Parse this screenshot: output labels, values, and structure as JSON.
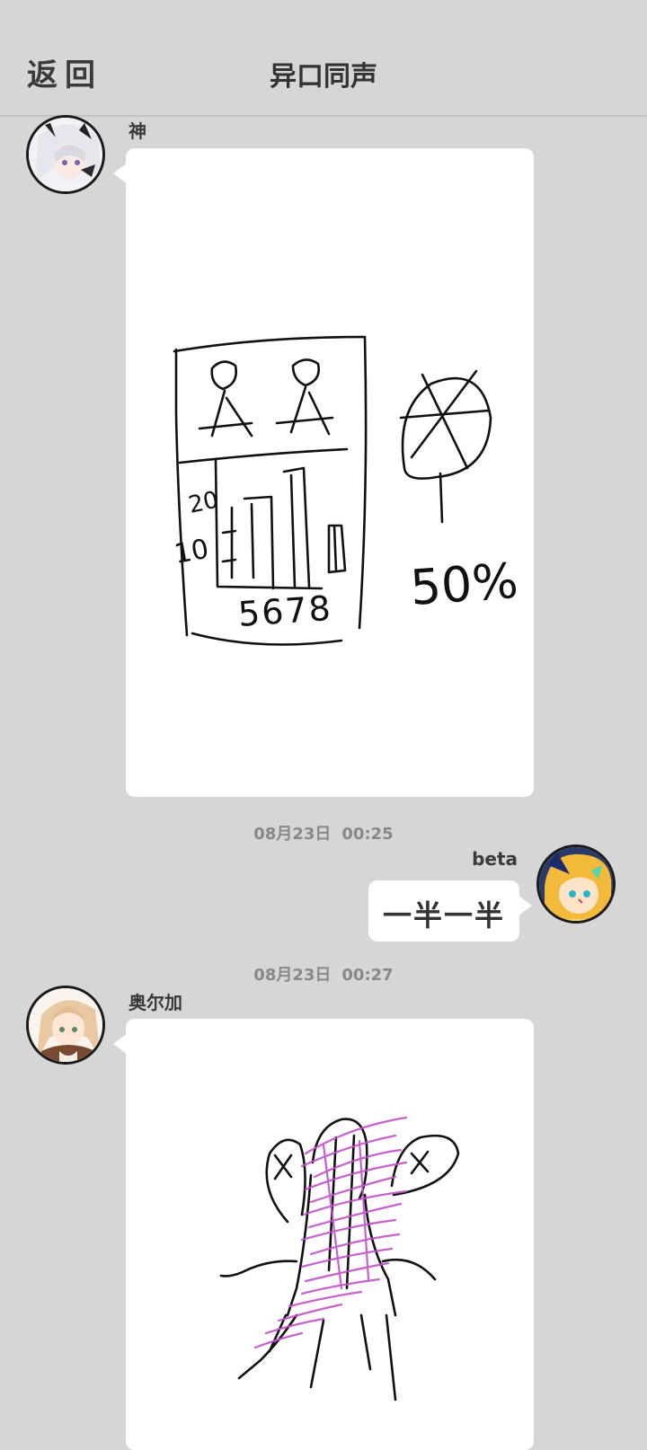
{
  "header": {
    "back_label": "返回",
    "title": "异口同声"
  },
  "messages": [
    {
      "sender": "神",
      "side": "left",
      "type": "drawing",
      "drawing_text": {
        "num_20": "20",
        "num_10": "10",
        "axis_nums": "5678",
        "percent": "50%"
      }
    },
    {
      "timestamp_date": "08月23日",
      "timestamp_time": "00:25",
      "sender": "beta",
      "side": "right",
      "type": "text",
      "text": "一半一半"
    },
    {
      "timestamp_date": "08月23日",
      "timestamp_time": "00:27",
      "sender": "奥尔加",
      "side": "left",
      "type": "drawing"
    }
  ],
  "colors": {
    "background": "#d6d6d6",
    "bubble": "#ffffff",
    "ink": "#111111",
    "purple_scribble": "#c050c8"
  }
}
